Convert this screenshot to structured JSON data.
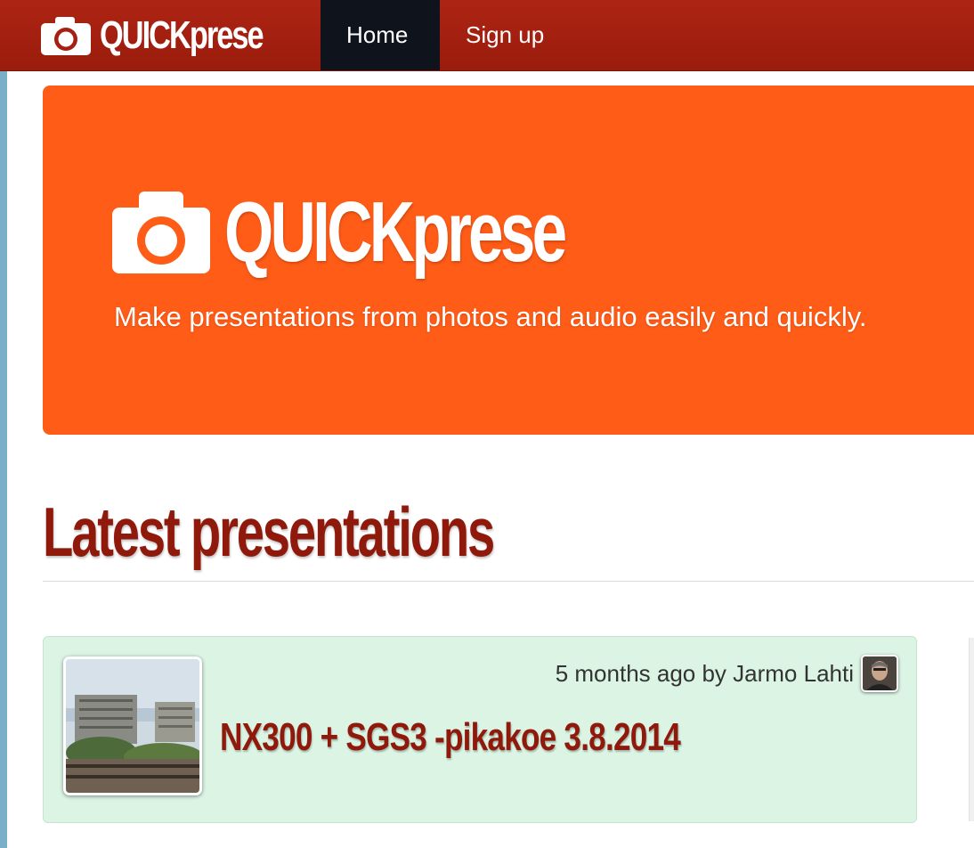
{
  "navbar": {
    "brand": "QUICKprese",
    "items": [
      {
        "label": "Home",
        "active": true
      },
      {
        "label": "Sign up",
        "active": false
      }
    ]
  },
  "hero": {
    "title": "QUICKprese",
    "tagline": "Make presentations from photos and audio easily and quickly."
  },
  "latest": {
    "heading": "Latest presentations",
    "presentations": [
      {
        "meta": "5 months ago by Jarmo Lahti",
        "title": "NX300 + SGS3 -pikakoe 3.8.2014"
      }
    ]
  },
  "colors": {
    "navbar": "#a52012",
    "nav_active": "#0e131c",
    "hero": "#ff5c17",
    "heading": "#8f1a0c",
    "card": "#dbf4e4"
  },
  "icons": {
    "brand": "camera-icon"
  }
}
